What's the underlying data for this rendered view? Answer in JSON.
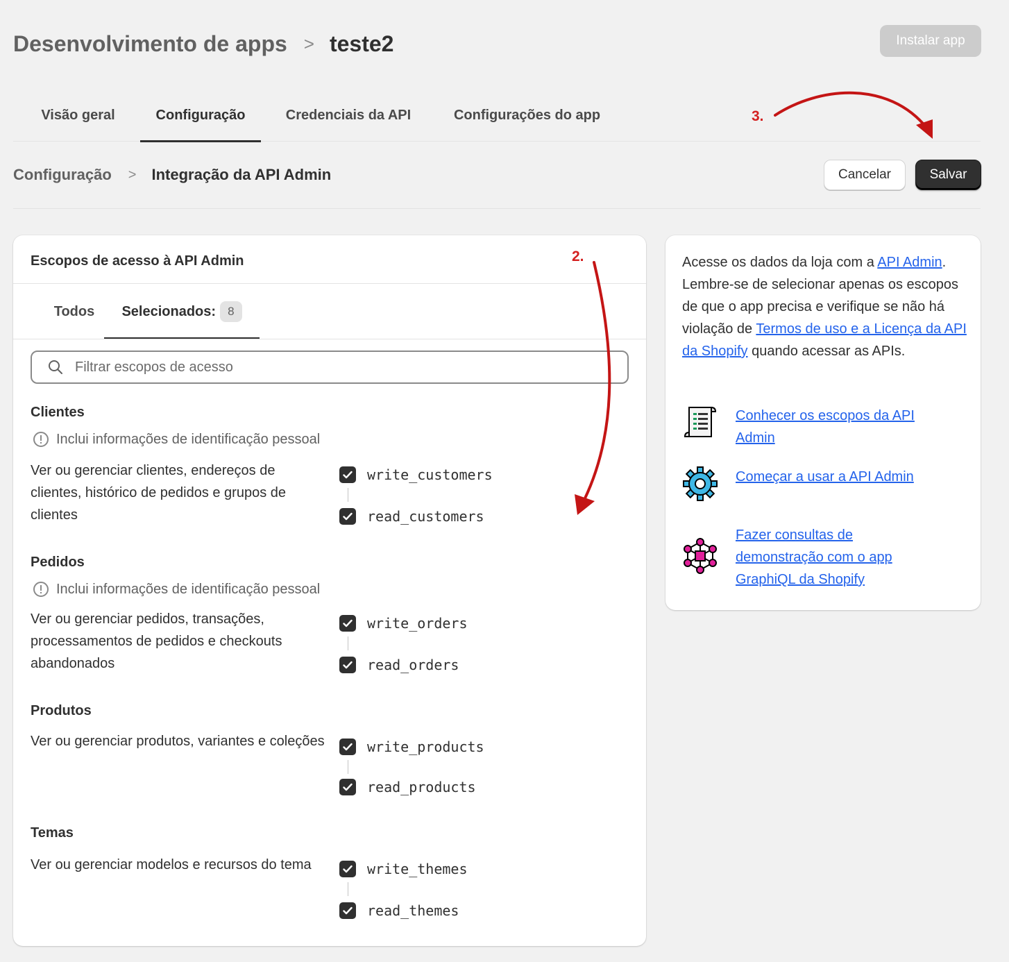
{
  "header": {
    "breadcrumb_parent": "Desenvolvimento de apps",
    "breadcrumb_sep": ">",
    "breadcrumb_current": "teste2",
    "install_button": "Instalar app"
  },
  "tabs": [
    {
      "label": "Visão geral",
      "active": false
    },
    {
      "label": "Configuração",
      "active": true
    },
    {
      "label": "Credenciais da API",
      "active": false
    },
    {
      "label": "Configurações do app",
      "active": false
    }
  ],
  "subheader": {
    "breadcrumb_parent": "Configuração",
    "breadcrumb_sep": ">",
    "breadcrumb_current": "Integração da API Admin",
    "cancel_button": "Cancelar",
    "save_button": "Salvar"
  },
  "annotations": {
    "step2": "2.",
    "step3": "3.",
    "color": "#d42020"
  },
  "scopes_card": {
    "title": "Escopos de acesso à API Admin",
    "tab_all": "Todos",
    "tab_selected": "Selecionados:",
    "selected_count": "8",
    "search_placeholder": "Filtrar escopos de acesso",
    "groups": [
      {
        "title": "Clientes",
        "pii_note": "Inclui informações de identificação pessoal",
        "description": "Ver ou gerenciar clientes, endereços de clientes, histórico de pedidos e grupos de clientes",
        "scopes": [
          {
            "name": "write_customers",
            "checked": true
          },
          {
            "name": "read_customers",
            "checked": true
          }
        ]
      },
      {
        "title": "Pedidos",
        "pii_note": "Inclui informações de identificação pessoal",
        "description": "Ver ou gerenciar pedidos, transações, processamentos de pedidos e checkouts abandonados",
        "scopes": [
          {
            "name": "write_orders",
            "checked": true
          },
          {
            "name": "read_orders",
            "checked": true
          }
        ]
      },
      {
        "title": "Produtos",
        "description": "Ver ou gerenciar produtos, variantes e coleções",
        "scopes": [
          {
            "name": "write_products",
            "checked": true
          },
          {
            "name": "read_products",
            "checked": true
          }
        ]
      },
      {
        "title": "Temas",
        "description": "Ver ou gerenciar modelos e recursos do tema",
        "scopes": [
          {
            "name": "write_themes",
            "checked": true
          },
          {
            "name": "read_themes",
            "checked": true
          }
        ]
      }
    ]
  },
  "side_card": {
    "intro_1": "Acesse os dados da loja com a ",
    "intro_link_1": "API Admin",
    "intro_2": ". Lembre-se de selecionar apenas os escopos de que o app precisa e verifique se não há violação de ",
    "intro_link_2": "Termos de uso e a Licença da API da Shopify",
    "intro_3": " quando acessar as APIs.",
    "links": [
      {
        "label": "Conhecer os escopos da API Admin",
        "icon": "scroll-document-icon"
      },
      {
        "label": "Começar a usar a API Admin",
        "icon": "gear-icon"
      },
      {
        "label": "Fazer consultas de demonstração com o app GraphiQL da Shopify",
        "icon": "graph-nodes-icon"
      }
    ],
    "link_color": "#2463eb"
  }
}
